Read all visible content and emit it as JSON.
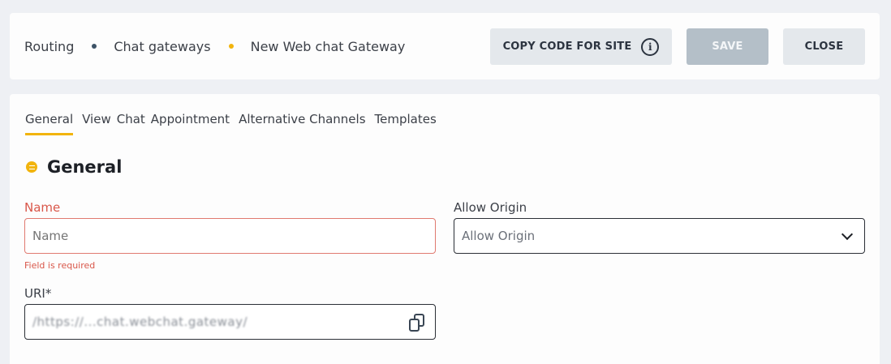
{
  "breadcrumb": {
    "items": [
      "Routing",
      "Chat gateways",
      "New Web chat Gateway"
    ],
    "dot_colors": [
      "#3d5266",
      "#f2b40d"
    ]
  },
  "toolbar": {
    "copy_label": "COPY CODE FOR SITE",
    "copy_icon": "info-icon",
    "save_label": "SAVE",
    "close_label": "CLOSE"
  },
  "tabs": [
    "General",
    "View",
    "Chat",
    "Appointment",
    "Alternative Channels",
    "Templates"
  ],
  "active_tab": "General",
  "section": {
    "title": "General",
    "icon": "chat-bubble-icon"
  },
  "form": {
    "name": {
      "label": "Name",
      "placeholder": "Name",
      "value": "",
      "error": "Field is required"
    },
    "allow_origin": {
      "label": "Allow Origin",
      "placeholder": "Allow Origin",
      "value": ""
    },
    "uri": {
      "label": "URI*",
      "value": "/https://...chat.webchat.gateway/",
      "action_icon": "copy-icon"
    }
  },
  "colors": {
    "accent": "#f2b40d",
    "error": "#d9574a",
    "disabled_button": "#b4bfc8"
  }
}
